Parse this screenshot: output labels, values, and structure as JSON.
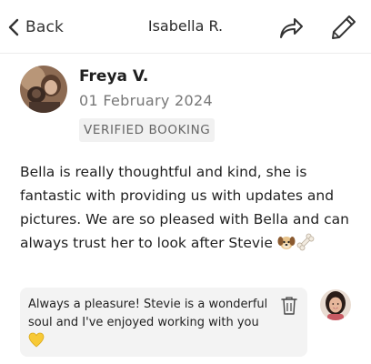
{
  "header": {
    "back_label": "Back",
    "title": "Isabella R.",
    "icons": {
      "back": "chevron-left-icon",
      "share": "share-arrow-icon",
      "edit": "pencil-icon"
    }
  },
  "review": {
    "reviewer_name": "Freya V.",
    "date": "01 February 2024",
    "badge": "VERIFIED BOOKING",
    "text": "Bella is really thoughtful and kind, she is fantastic with providing us with updates and pictures. We are so pleased with Bella and can always trust her to look after Stevie",
    "emojis": [
      "dog-face-emoji",
      "bone-emoji"
    ]
  },
  "reply": {
    "text": "Always a pleasure! Stevie is a wonderful soul and I've enjoyed working with you",
    "emoji": "yellow-heart-emoji",
    "delete_icon": "trash-icon"
  },
  "colors": {
    "badge_bg": "#f1f1f1",
    "reply_bg": "#f3f3f3",
    "date_text": "#777777",
    "divider": "#ececec"
  }
}
